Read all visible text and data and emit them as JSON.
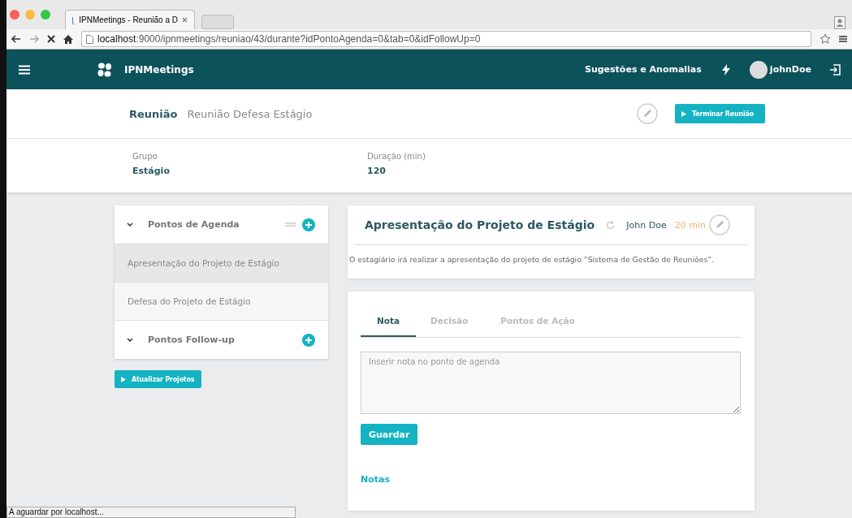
{
  "browser": {
    "tab_title": "IPNMeetings - Reunião a D",
    "url_host": "localhost",
    "url_rest": ":9000/ipnmeetings/reuniao/43/durante?idPontoAgenda=0&tab=0&idFollowUp=0"
  },
  "navbar": {
    "brand": "IPNMeetings",
    "link": "Sugestões e Anomalias",
    "user": "johnDoe"
  },
  "header": {
    "label": "Reunião",
    "name": "Reunião Defesa Estágio",
    "button": "Terminar Reunião"
  },
  "info": [
    {
      "label": "Grupo",
      "value": "Estágio"
    },
    {
      "label": "Duração (min)",
      "value": "120"
    }
  ],
  "agenda": {
    "title": "Pontos de Agenda",
    "items": [
      {
        "label": "Apresentação do Projeto de Estágio",
        "selected": true
      },
      {
        "label": "Defesa do Projeto de Estágio",
        "selected": false
      }
    ],
    "followup_title": "Pontos Follow-up",
    "button": "Atualizar Projetos"
  },
  "point": {
    "title": "Apresentação do Projeto de Estágio",
    "owner": "John Doe",
    "duration": "20 min",
    "description": "O estagiário irá realizar a apresentação do projeto de estágio “Sistema de Gestão de Reuniões”."
  },
  "tabs": [
    {
      "label": "Nota",
      "selected": true
    },
    {
      "label": "Decisão",
      "selected": false
    },
    {
      "label": "Pontos de Ação",
      "selected": false
    }
  ],
  "note": {
    "placeholder": "Inserir nota no ponto de agenda",
    "button": "Guardar",
    "notes_title": "Notas"
  },
  "status_bar": "A aguardar por localhost..."
}
